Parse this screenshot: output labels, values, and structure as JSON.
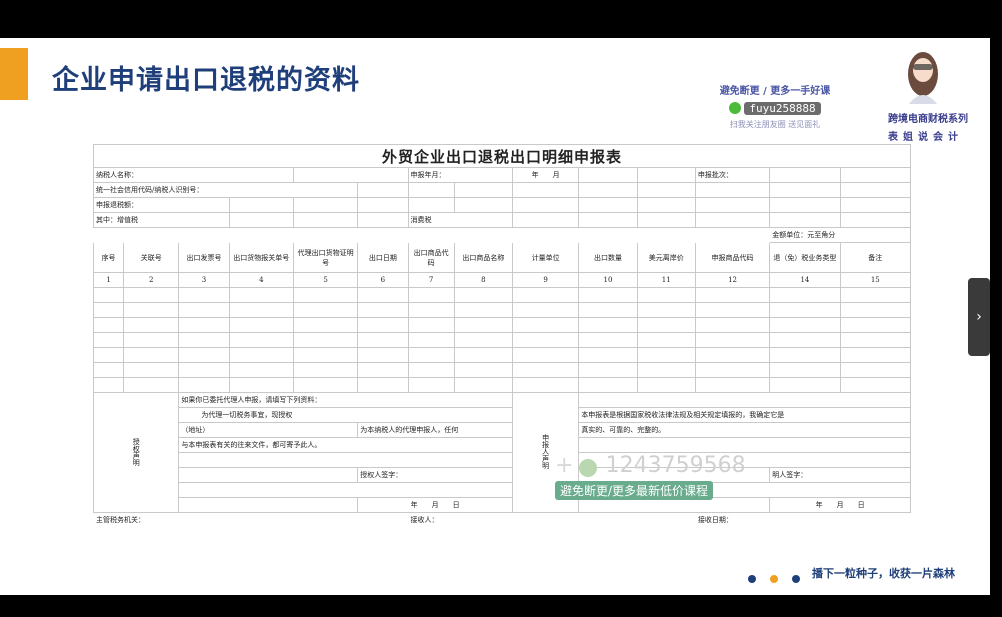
{
  "slide": {
    "title": "企业申请出口退税的资料",
    "promo_line1": "避免断更 / 更多一手好课",
    "promo_wechat": "fuyu258888",
    "promo_line3": "扫我关注朋友圈 送见面礼",
    "series": "跨境电商财税系列",
    "presenter": "表姐说会计",
    "slogan": "播下一粒种子，收获一片森林",
    "dot_colors": [
      "#1f3f7a",
      "#f0a020",
      "#1f3f7a"
    ]
  },
  "form": {
    "title": "外贸企业出口退税出口明细申报表",
    "taxpayer_name_label": "纳税人名称：",
    "declare_month_label": "申报年月：",
    "year_label": "年",
    "month_label": "月",
    "batch_label": "申报批次：",
    "credit_code_label": "统一社会信用代码/纳税人识别号：",
    "refund_amount_label": "申报退税额：",
    "vat_label": "其中：增值税",
    "consumption_tax_label": "消费税",
    "unit_label": "金额单位：元至角分",
    "columns": [
      "序号",
      "关联号",
      "出口发票号",
      "出口货物报关单号",
      "代理出口货物证明号",
      "出口日期",
      "出口商品代码",
      "出口商品名称",
      "计量单位",
      "出口数量",
      "美元离岸价",
      "申报商品代码",
      "退（免）税业务类型",
      "备注"
    ],
    "column_numbers": [
      "1",
      "2",
      "3",
      "4",
      "5",
      "6",
      "7",
      "8",
      "9",
      "10",
      "11",
      "12",
      "14",
      "15"
    ],
    "authorization": {
      "label": "授权声明",
      "line1": "如果你已委托代理人申报，请填写下列资料：",
      "line2": "为代理一切税务事宜，现授权",
      "line3a": "（地址）",
      "line3b": "为本纳税人的代理申报人，任何",
      "line4": "与本申报表有关的往来文件，都可寄予此人。",
      "signature": "授权人签字：",
      "date": "年　　月　　日"
    },
    "declaration": {
      "label": "申报人声明",
      "line1": "本申报表是根据国家税收法律法规及相关规定填报的，我确定它是",
      "line2": "真实的、可靠的、完整的。",
      "signature": "明人签字：",
      "date": "年　　月　　日"
    },
    "tax_authority_label": "主管税务机关：",
    "receiver_label": "接收人：",
    "receive_date_label": "接收日期："
  },
  "watermark": {
    "plus": "+",
    "phone": "1243759568",
    "badge": "避免断更/更多最新低价课程"
  },
  "nav": {
    "next_arrow": "›"
  }
}
